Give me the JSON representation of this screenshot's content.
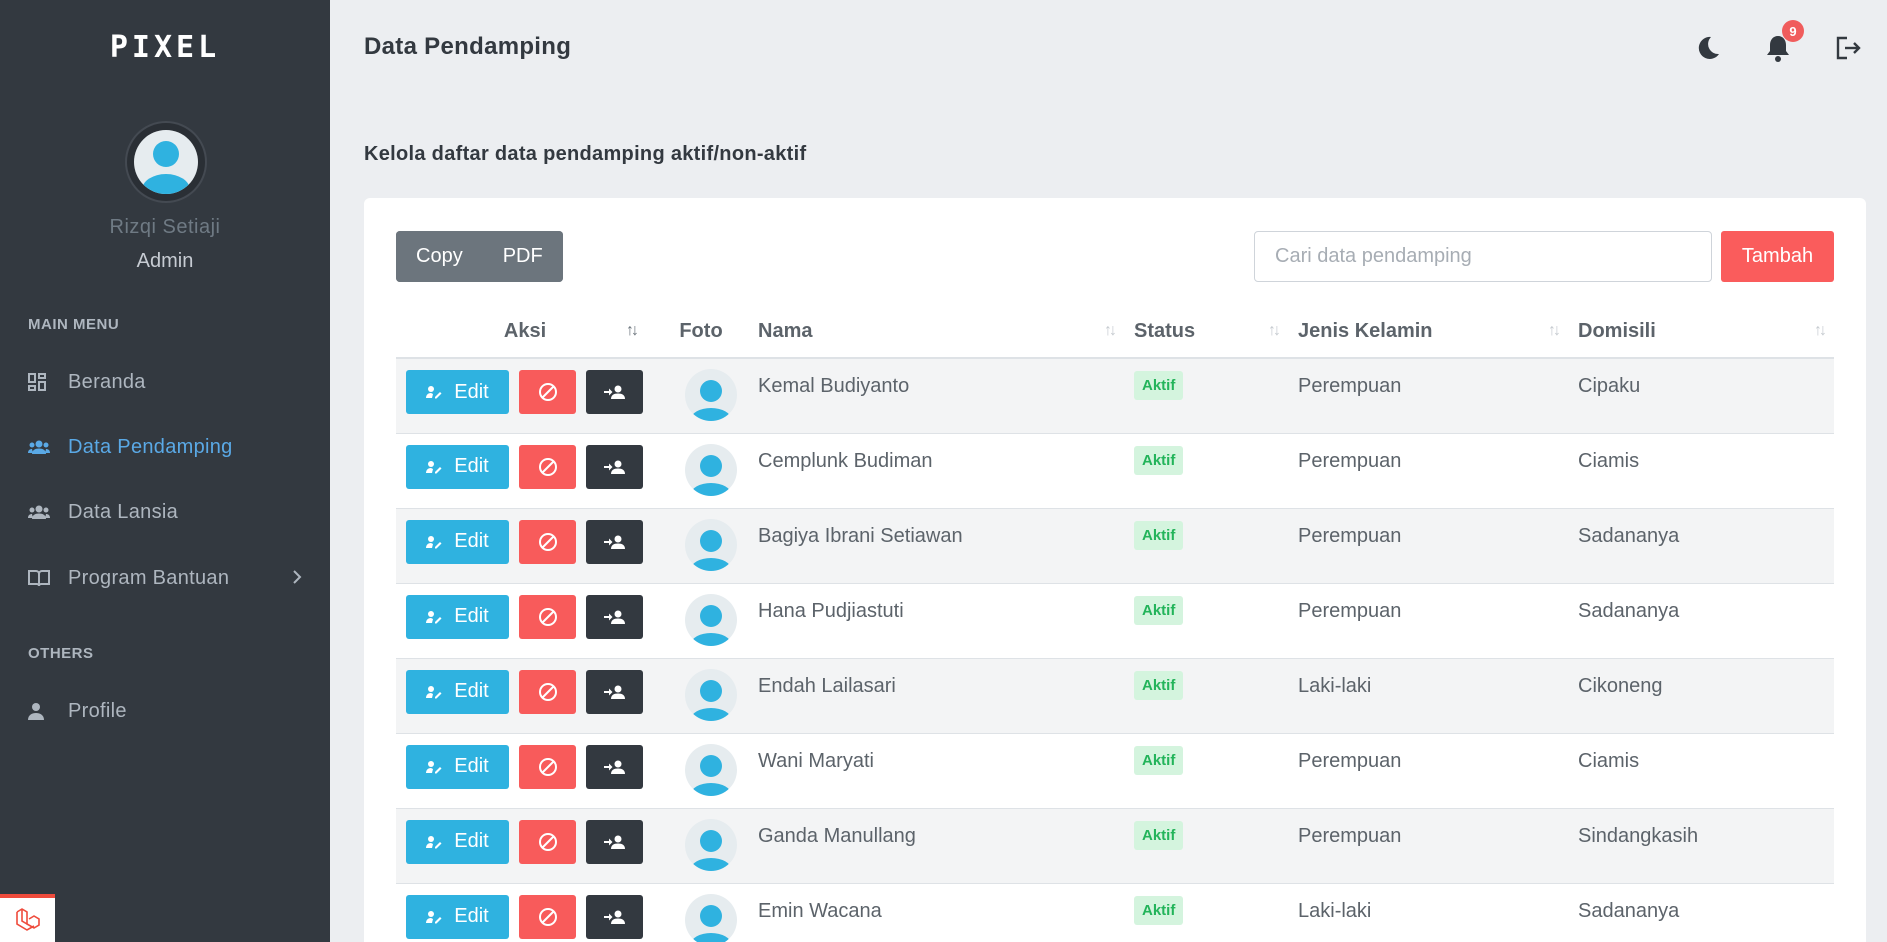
{
  "sidebar": {
    "brand": "PIXEL",
    "user_name": "Rizqi Setiaji",
    "user_role": "Admin",
    "main_menu_label": "MAIN MENU",
    "others_label": "OTHERS",
    "items": [
      {
        "label": "Beranda",
        "icon": "dashboard-icon"
      },
      {
        "label": "Data Pendamping",
        "icon": "group-icon",
        "active": true
      },
      {
        "label": "Data Lansia",
        "icon": "group-icon"
      },
      {
        "label": "Program Bantuan",
        "icon": "book-icon"
      },
      {
        "label": "Profile",
        "icon": "person-icon"
      }
    ]
  },
  "header": {
    "title": "Data Pendamping",
    "notification_count": "9"
  },
  "main": {
    "subtitle": "Kelola daftar data pendamping aktif/non-aktif",
    "copy_label": "Copy",
    "pdf_label": "PDF",
    "search_placeholder": "Cari data pendamping",
    "add_label": "Tambah",
    "edit_label": "Edit"
  },
  "table": {
    "columns": [
      "Aksi",
      "Foto",
      "Nama",
      "Status",
      "Jenis Kelamin",
      "Domisili"
    ],
    "rows": [
      {
        "nama": "Kemal Budiyanto",
        "status": "Aktif",
        "jk": "Perempuan",
        "domisili": "Cipaku"
      },
      {
        "nama": "Cemplunk Budiman",
        "status": "Aktif",
        "jk": "Perempuan",
        "domisili": "Ciamis"
      },
      {
        "nama": "Bagiya Ibrani Setiawan",
        "status": "Aktif",
        "jk": "Perempuan",
        "domisili": "Sadananya"
      },
      {
        "nama": "Hana Pudjiastuti",
        "status": "Aktif",
        "jk": "Perempuan",
        "domisili": "Sadananya"
      },
      {
        "nama": "Endah Lailasari",
        "status": "Aktif",
        "jk": "Laki-laki",
        "domisili": "Cikoneng"
      },
      {
        "nama": "Wani Maryati",
        "status": "Aktif",
        "jk": "Perempuan",
        "domisili": "Ciamis"
      },
      {
        "nama": "Ganda Manullang",
        "status": "Aktif",
        "jk": "Perempuan",
        "domisili": "Sindangkasih"
      },
      {
        "nama": "Emin Wacana",
        "status": "Aktif",
        "jk": "Laki-laki",
        "domisili": "Sadananya"
      }
    ]
  },
  "colors": {
    "sidebar_bg": "#333940",
    "active": "#5aa9e6",
    "edit": "#2fb2e0",
    "danger": "#f85b5b",
    "dark": "#333940",
    "status_bg": "#d4f4de",
    "status_text": "#23b45a"
  }
}
